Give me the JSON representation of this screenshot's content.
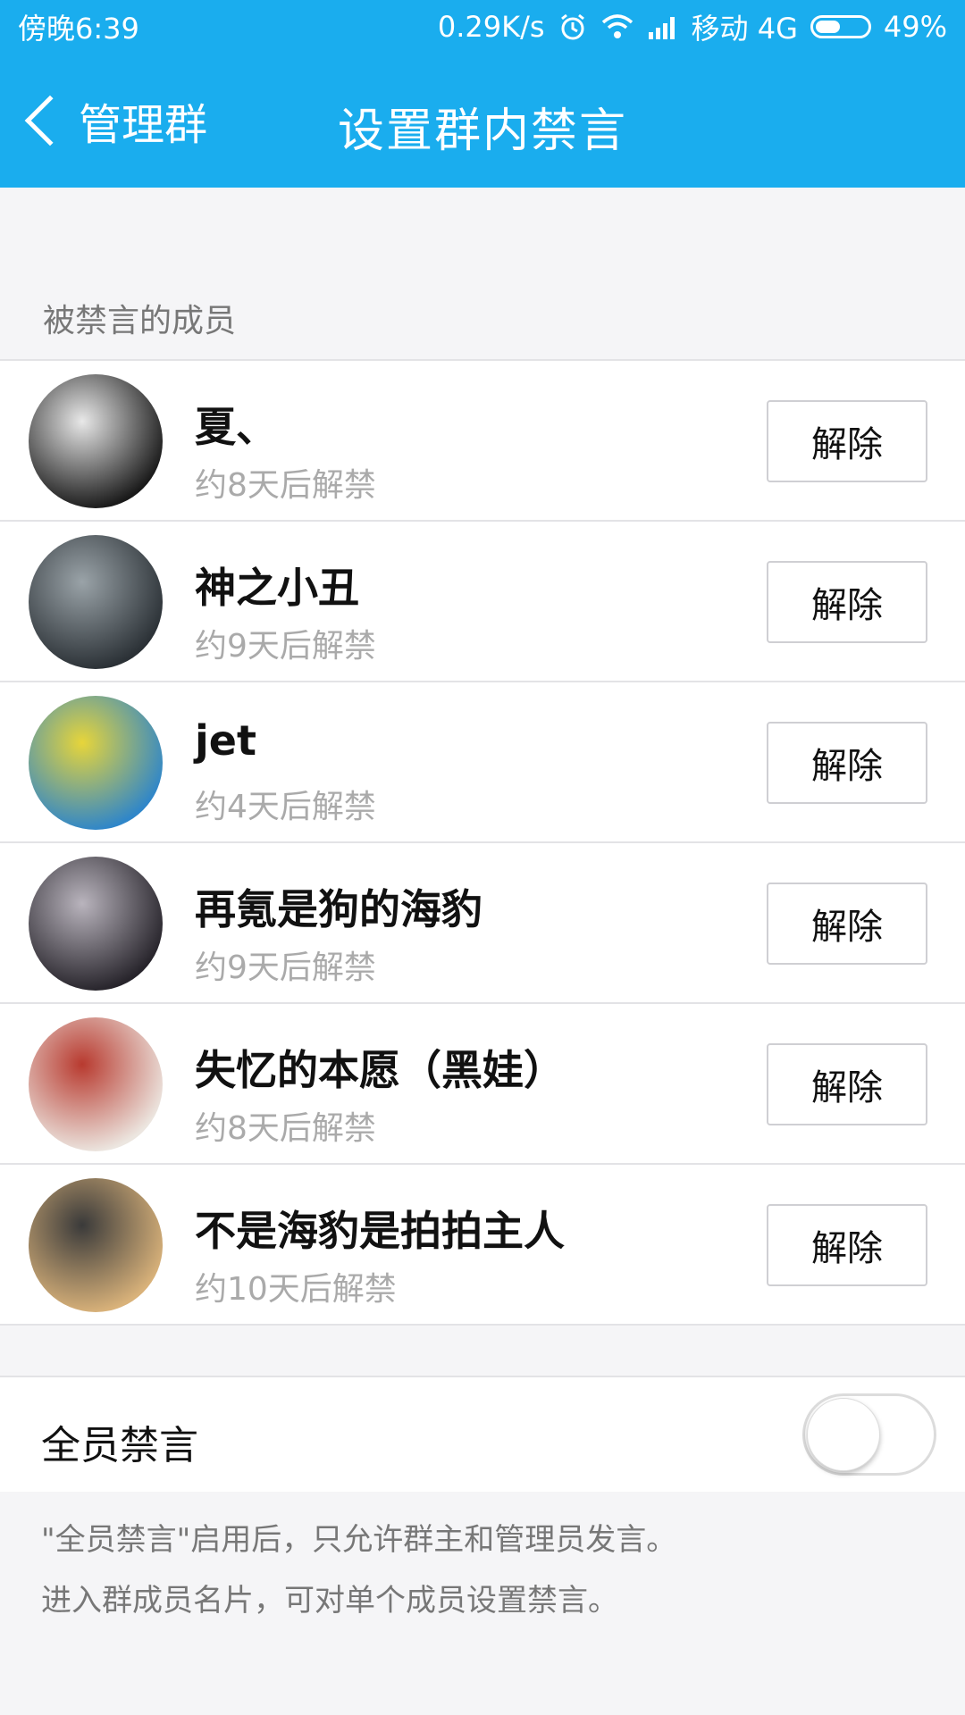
{
  "status_bar": {
    "time": "傍晚6:39",
    "net_speed": "0.29K/s",
    "carrier": "移动 4G",
    "battery_pct": "49%",
    "battery_level": 0.49,
    "icons": [
      "alarm-icon",
      "wifi-icon",
      "signal-icon",
      "battery-icon"
    ]
  },
  "header": {
    "back_label": "管理群",
    "title": "设置群内禁言",
    "bg_color": "#1aadee"
  },
  "section_label": "被禁言的成员",
  "members": [
    {
      "name": "夏、",
      "status": "约8天后解禁",
      "button": "解除",
      "avatar_colors": [
        "#1a1a1a",
        "#e8e8e8"
      ]
    },
    {
      "name": "神之小丑",
      "status": "约9天后解禁",
      "button": "解除",
      "avatar_colors": [
        "#2b3136",
        "#9aa3a8"
      ]
    },
    {
      "name": "jet",
      "status": "约4天后解禁",
      "button": "解除",
      "avatar_colors": [
        "#2f86c9",
        "#e7d53a"
      ]
    },
    {
      "name": "再氪是狗的海豹",
      "status": "约9天后解禁",
      "button": "解除",
      "avatar_colors": [
        "#27242b",
        "#b9b4bd"
      ]
    },
    {
      "name": "失忆的本愿（黑娃）",
      "status": "约8天后解禁",
      "button": "解除",
      "avatar_colors": [
        "#ece6e0",
        "#b83a2f"
      ]
    },
    {
      "name": "不是海豹是拍拍主人",
      "status": "约10天后解禁",
      "button": "解除",
      "avatar_colors": [
        "#d9b27a",
        "#3a3a3a"
      ]
    }
  ],
  "all_mute": {
    "label": "全员禁言",
    "enabled": false
  },
  "notes": [
    "\"全员禁言\"启用后，只允许群主和管理员发言。",
    "进入群成员名片，可对单个成员设置禁言。"
  ]
}
